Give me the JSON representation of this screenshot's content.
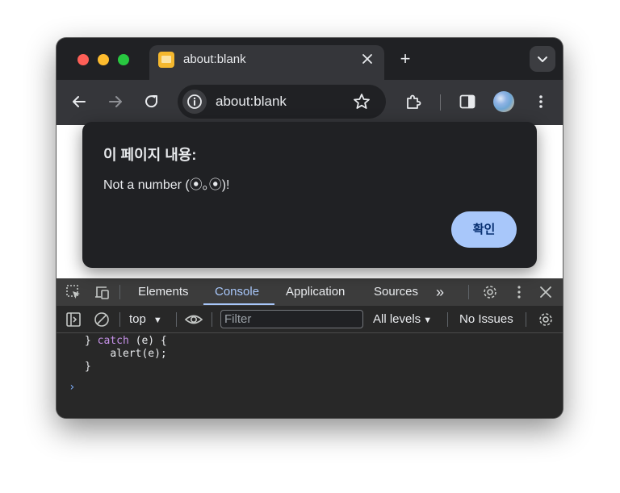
{
  "browser": {
    "tab": {
      "title": "about:blank",
      "close_icon": "close-icon",
      "favicon": "page-favicon-icon"
    },
    "new_tab_label": "+",
    "omnibox": {
      "url": "about:blank"
    },
    "colors": {
      "frame": "#202124",
      "toolbar": "#35363a",
      "accent_blue": "#a8c7fa",
      "close": "#fe5f57",
      "minimize": "#febc2e",
      "maximize": "#28c840"
    }
  },
  "dialog": {
    "title": "이 페이지 내용:",
    "message": "Not a number (⦿｡⦿)!",
    "ok_label": "확인"
  },
  "devtools": {
    "tabs": [
      "Elements",
      "Console",
      "Application",
      "Sources"
    ],
    "active_tab": "Console",
    "more_tabs": "»",
    "filterbar": {
      "context": "top",
      "filter_placeholder": "Filter",
      "levels": "All levels",
      "issues": "No Issues"
    },
    "console": {
      "lines": [
        {
          "indent": "} ",
          "keyword": "catch",
          "rest": " (e) {"
        },
        {
          "indent": "    ",
          "keyword": "",
          "rest": "alert(e);"
        },
        {
          "indent": "}",
          "keyword": "",
          "rest": ""
        }
      ],
      "prompt": "›"
    }
  }
}
